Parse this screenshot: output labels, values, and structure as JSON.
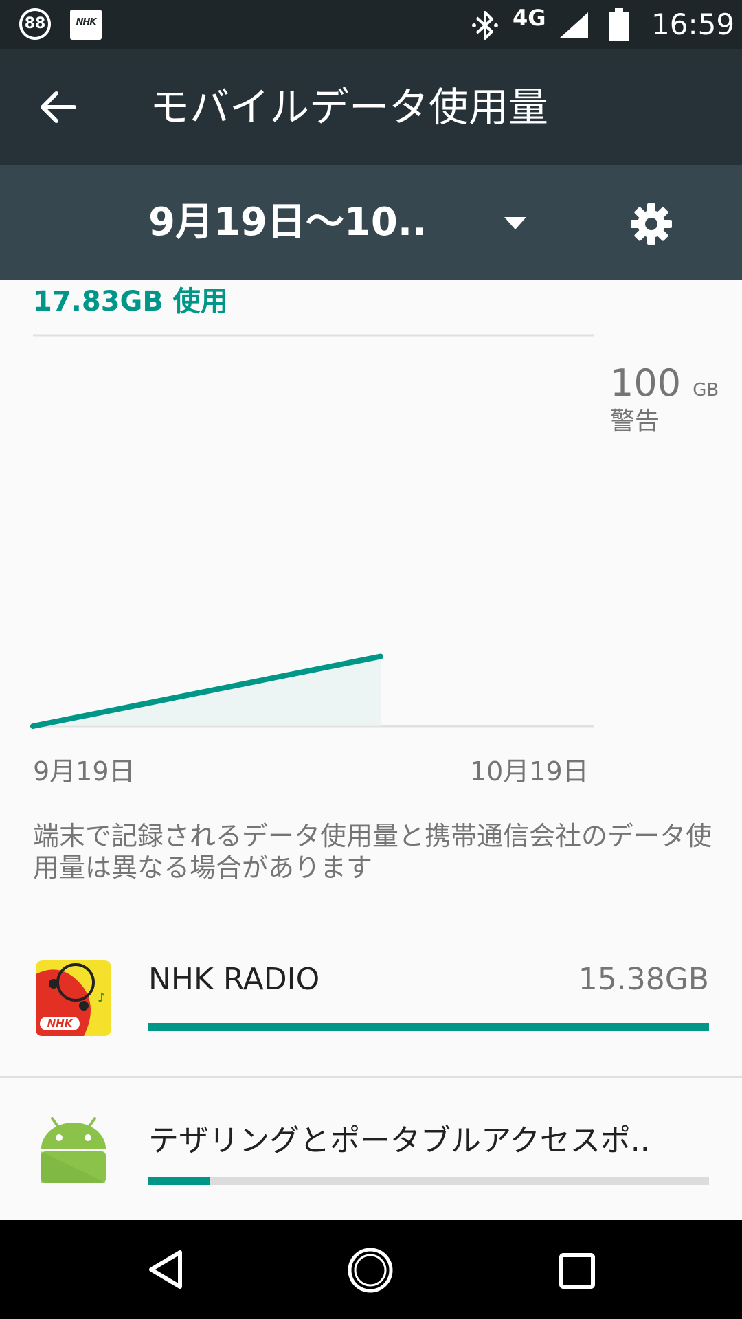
{
  "status_bar": {
    "radio_badge": "88",
    "nhk_badge": "NHK",
    "network": "4G",
    "time": "16:59"
  },
  "toolbar": {
    "title": "モバイルデータ使用量"
  },
  "period_selector": {
    "value": "9月19日〜10.."
  },
  "summary": {
    "usage": "17.83GB 使用"
  },
  "chart": {
    "warning_value": "100",
    "warning_unit": "GB",
    "warning_label": "警告",
    "x_start": "9月19日",
    "x_end": "10月19日"
  },
  "chart_data": {
    "type": "area",
    "title": "",
    "x_range": [
      "9月19日",
      "10月19日"
    ],
    "ylim": [
      0,
      100
    ],
    "series": [
      {
        "x": [
          0,
          0.62
        ],
        "values": [
          0,
          17.83
        ]
      }
    ],
    "warning_line": 100,
    "grid": false
  },
  "note": "端末で記録されるデータ使用量と携帯通信会社のデータ使用量は異なる場合があります",
  "apps": [
    {
      "name": "NHK RADIO",
      "usage": "15.38GB",
      "share": 1.0,
      "nhk_text": "NHK"
    },
    {
      "name": "テザリングとポータブルアクセスポ..",
      "usage": "",
      "share": 0.11
    }
  ],
  "colors": {
    "accent": "#009688",
    "status_bar": "#1e2629",
    "app_bar": "#263238",
    "period_bar": "#37474f"
  }
}
